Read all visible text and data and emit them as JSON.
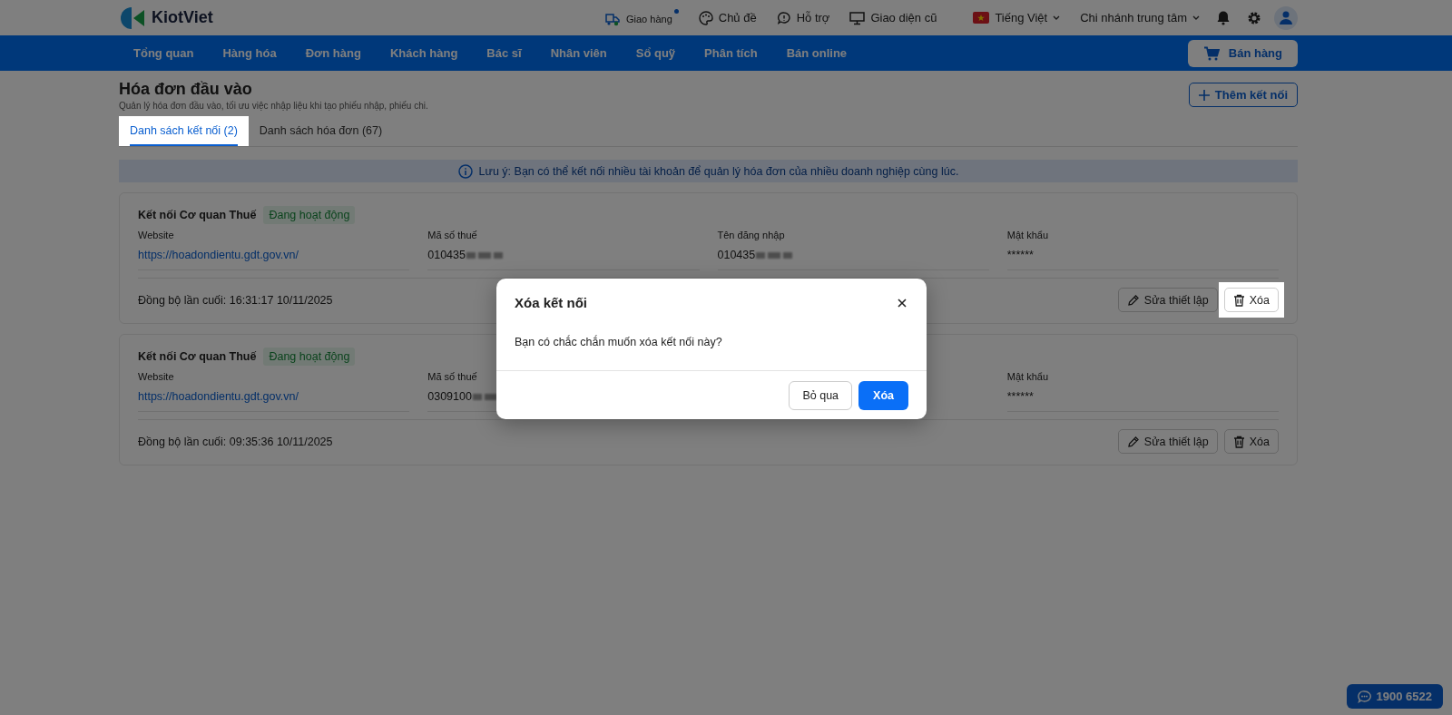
{
  "header": {
    "brand": "KiotViet",
    "links": [
      {
        "label": "Giao hàng",
        "kind": "delivery",
        "notification": true
      },
      {
        "label": "Chủ đề",
        "kind": "theme",
        "notification": false
      },
      {
        "label": "Hỗ trợ",
        "kind": "support",
        "notification": false
      },
      {
        "label": "Giao diện cũ",
        "kind": "monitor",
        "notification": false
      },
      {
        "label": "Tiếng Việt",
        "kind": "language",
        "notification": false
      },
      {
        "label": "Chi nhánh trung tâm",
        "kind": "branch",
        "notification": false
      }
    ]
  },
  "nav": {
    "items": [
      "Tổng quan",
      "Hàng hóa",
      "Đơn hàng",
      "Khách hàng",
      "Bác sĩ",
      "Nhân viên",
      "Sổ quỹ",
      "Phân tích",
      "Bán online"
    ],
    "sell_button": "Bán hàng"
  },
  "page": {
    "title": "Hóa đơn đầu vào",
    "subtitle": "Quản lý hóa đơn đầu vào, tối ưu việc nhập liệu khi tạo phiếu nhập, phiếu chi.",
    "add_button": "Thêm kết nối",
    "tabs": [
      {
        "label": "Danh sách kết nối (2)",
        "selected": true,
        "spotlight": true
      },
      {
        "label": "Danh sách hóa đơn (67)",
        "selected": false,
        "spotlight": false
      }
    ],
    "notice": "Lưu ý: Bạn có thể kết nối nhiều tài khoản để quản lý hóa đơn của nhiều doanh nghiệp cùng lúc."
  },
  "cards": [
    {
      "title": "Kết nối Cơ quan Thuế",
      "status": "Đang hoạt động",
      "fields": [
        {
          "label": "Website",
          "value": "https://hoadondientu.gdt.gov.vn/",
          "kind": "link",
          "blurred": false
        },
        {
          "label": "Mã số thuế",
          "value": "010435",
          "kind": "text",
          "blurred": true
        },
        {
          "label": "Tên đăng nhập",
          "value": "010435",
          "kind": "text",
          "blurred": true
        },
        {
          "label": "Mật khẩu",
          "value": "******",
          "kind": "text",
          "blurred": false
        }
      ],
      "last_sync": "Đồng bộ lần cuối: 16:31:17 10/11/2025",
      "actions": [
        {
          "label": "Sửa thiết lập",
          "kind": "edit",
          "spotlight": false
        },
        {
          "label": "Xóa",
          "kind": "delete",
          "spotlight": true
        }
      ]
    },
    {
      "title": "Kết nối Cơ quan Thuế",
      "status": "Đang hoạt động",
      "fields": [
        {
          "label": "Website",
          "value": "https://hoadondientu.gdt.gov.vn/",
          "kind": "link",
          "blurred": false
        },
        {
          "label": "Mã số thuế",
          "value": "0309100",
          "kind": "text",
          "blurred": true
        },
        {
          "label": "Mật khẩu",
          "value": "******",
          "kind": "text",
          "blurred": false
        }
      ],
      "last_sync": "Đồng bộ lần cuối: 09:35:36 10/11/2025",
      "actions": [
        {
          "label": "Sửa thiết lập",
          "kind": "edit",
          "spotlight": false
        },
        {
          "label": "Xóa",
          "kind": "delete",
          "spotlight": false
        }
      ]
    }
  ],
  "modal": {
    "title": "Xóa kết nối",
    "message": "Bạn có chắc chắn muốn xóa kết nối này?",
    "buttons": [
      {
        "label": "Bỏ qua",
        "kind": "secondary"
      },
      {
        "label": "Xóa",
        "kind": "primary"
      }
    ]
  },
  "hotline": "1900 6522"
}
